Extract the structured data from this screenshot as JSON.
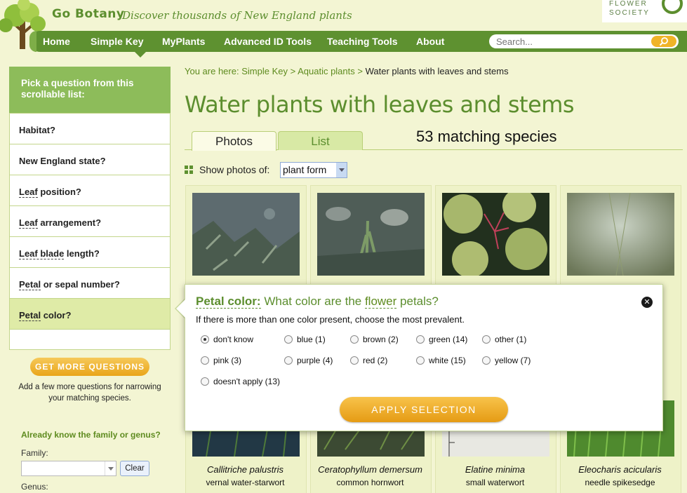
{
  "header": {
    "brand": "Go Botany",
    "tagline": "Discover thousands of New England plants",
    "society_line1": "FLOWER",
    "society_line2": "SOCIETY"
  },
  "nav": {
    "items": [
      "Home",
      "Simple Key",
      "MyPlants",
      "Advanced ID Tools",
      "Teaching Tools",
      "About"
    ],
    "search_placeholder": "Search..."
  },
  "sidebar": {
    "heading": "Pick a question from this scrollable list:",
    "questions": [
      {
        "pre": "",
        "u": "",
        "label": "Habitat?"
      },
      {
        "pre": "",
        "u": "",
        "label": "New England state?"
      },
      {
        "pre": "",
        "u": "Leaf",
        "label": " position?"
      },
      {
        "pre": "",
        "u": "Leaf",
        "label": " arrangement?"
      },
      {
        "pre": "",
        "u": "Leaf blade",
        "label": " length?"
      },
      {
        "pre": "",
        "u": "Petal",
        "label": " or sepal number?"
      },
      {
        "pre": "",
        "u": "Petal",
        "label": " color?"
      }
    ],
    "more_button": "GET MORE QUESTIONS",
    "more_text": "Add a few more questions for narrowing your matching species.",
    "already": "Already know the family or genus?",
    "family_label": "Family:",
    "clear_button": "Clear",
    "genus_label": "Genus:"
  },
  "breadcrumb": {
    "prefix": "You are here:",
    "links": [
      "Simple Key",
      "Aquatic plants"
    ],
    "current": "Water plants with leaves and stems",
    "sep": ">"
  },
  "main": {
    "title": "Water plants with leaves and stems",
    "tabs": [
      "Photos",
      "List"
    ],
    "match_count": "53 matching species",
    "show_label": "Show photos of:",
    "show_value": "plant form"
  },
  "species": [
    {
      "sci": "Callitriche palustris",
      "common": "vernal water-starwort"
    },
    {
      "sci": "Ceratophyllum demersum",
      "common": "common hornwort"
    },
    {
      "sci": "Elatine minima",
      "common": "small waterwort"
    },
    {
      "sci": "Eleocharis acicularis",
      "common": "needle spikesedge"
    }
  ],
  "popup": {
    "char": "Petal color:",
    "q_pre": "What color are the ",
    "q_flower": "flower",
    "q_post": " petals?",
    "sub": "If there is more than one color present, choose the most prevalent.",
    "options": [
      [
        "don't know",
        "blue (1)",
        "brown (2)",
        "green (14)",
        "other (1)"
      ],
      [
        "pink (3)",
        "purple (4)",
        "red (2)",
        "white (15)",
        "yellow (7)"
      ],
      [
        "doesn't apply (13)"
      ]
    ],
    "selected": "don't know",
    "apply": "APPLY SELECTION",
    "close": "✕"
  },
  "colors": {
    "nav_green": "#5e9130",
    "title_green": "#5c8e2e",
    "sidebar_head": "#8dbc5a",
    "button_orange": "#f0b428",
    "background": "#f3f5d3"
  }
}
